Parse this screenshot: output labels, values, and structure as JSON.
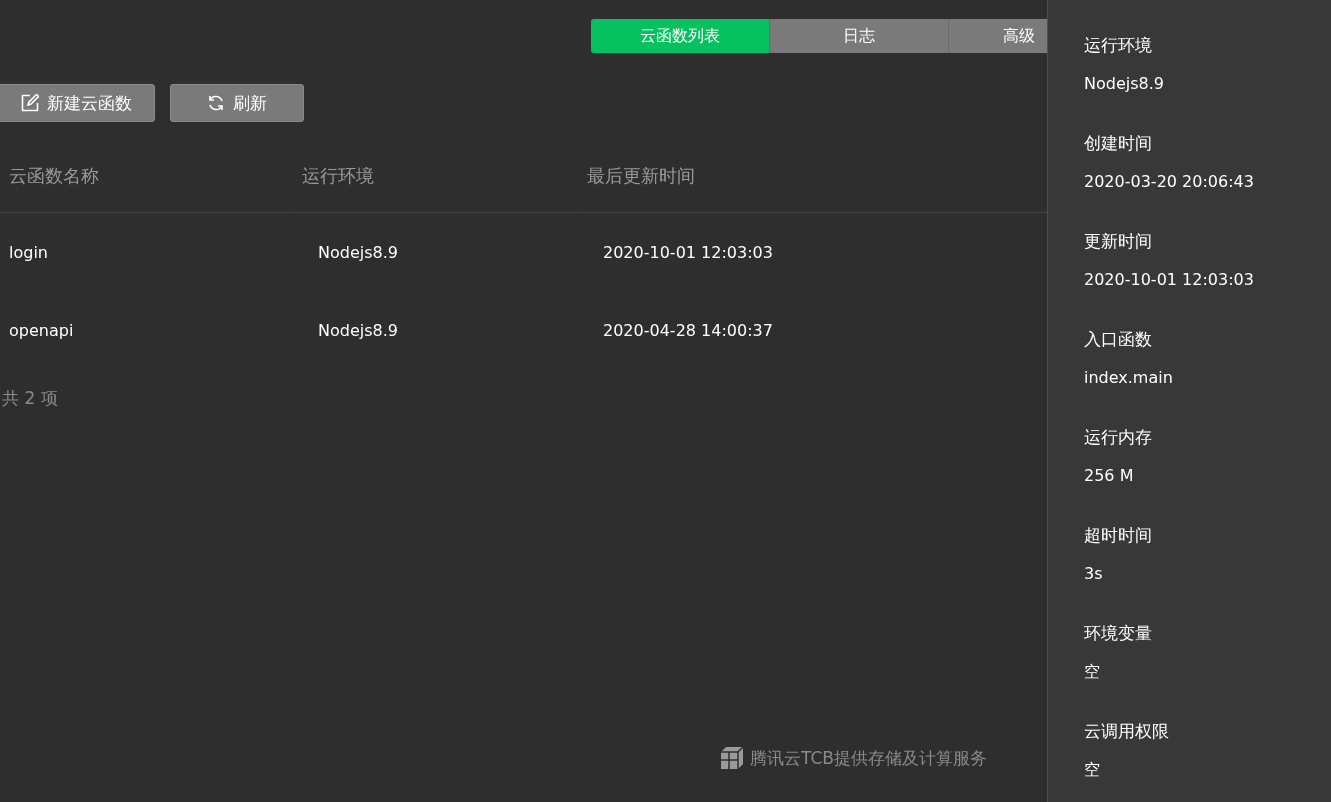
{
  "tabs": [
    {
      "label": "云函数列表",
      "selected": true
    },
    {
      "label": "日志",
      "selected": false
    },
    {
      "label": "高级",
      "selected": false
    }
  ],
  "toolbar": [
    {
      "label": "新建云函数",
      "kind": "new"
    },
    {
      "label": "刷新",
      "kind": "refresh"
    }
  ],
  "table": {
    "columns": [
      "云函数名称",
      "运行环境",
      "最后更新时间"
    ],
    "rows": [
      [
        "login",
        "Nodejs8.9",
        "2020-10-01 12:03:03"
      ],
      [
        "openapi",
        "Nodejs8.9",
        "2020-04-28 14:00:37"
      ]
    ]
  },
  "total": "共 2 项",
  "footer": "腾讯云TCB提供存储及计算服务",
  "details": [
    {
      "label": "运行环境",
      "value": "Nodejs8.9"
    },
    {
      "label": "创建时间",
      "value": "2020-03-20 20:06:43"
    },
    {
      "label": "更新时间",
      "value": "2020-10-01 12:03:03"
    },
    {
      "label": "入口函数",
      "value": "index.main"
    },
    {
      "label": "运行内存",
      "value": "256 M"
    },
    {
      "label": "超时时间",
      "value": "3s"
    },
    {
      "label": "环境变量",
      "value": "空"
    },
    {
      "label": "云调用权限",
      "value": "空"
    }
  ]
}
